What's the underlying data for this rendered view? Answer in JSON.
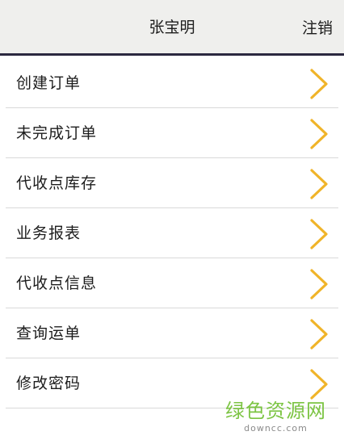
{
  "header": {
    "title": "张宝明",
    "logout_label": "注销"
  },
  "menu": {
    "items": [
      {
        "label": "创建订单",
        "icon": "chevron-right-icon"
      },
      {
        "label": "未完成订单",
        "icon": "chevron-right-icon"
      },
      {
        "label": "代收点库存",
        "icon": "chevron-right-icon"
      },
      {
        "label": "业务报表",
        "icon": "chevron-right-icon"
      },
      {
        "label": "代收点信息",
        "icon": "chevron-right-icon"
      },
      {
        "label": "查询运单",
        "icon": "chevron-right-icon"
      },
      {
        "label": "修改密码",
        "icon": "chevron-right-icon"
      }
    ]
  },
  "watermark": {
    "main": "绿色资源网",
    "sub": "downcc.com"
  },
  "colors": {
    "header_bg": "#efefed",
    "header_border": "#2b2840",
    "chevron": "#f0b429",
    "divider": "#d9d9d9",
    "watermark_green": "#7cc443"
  }
}
